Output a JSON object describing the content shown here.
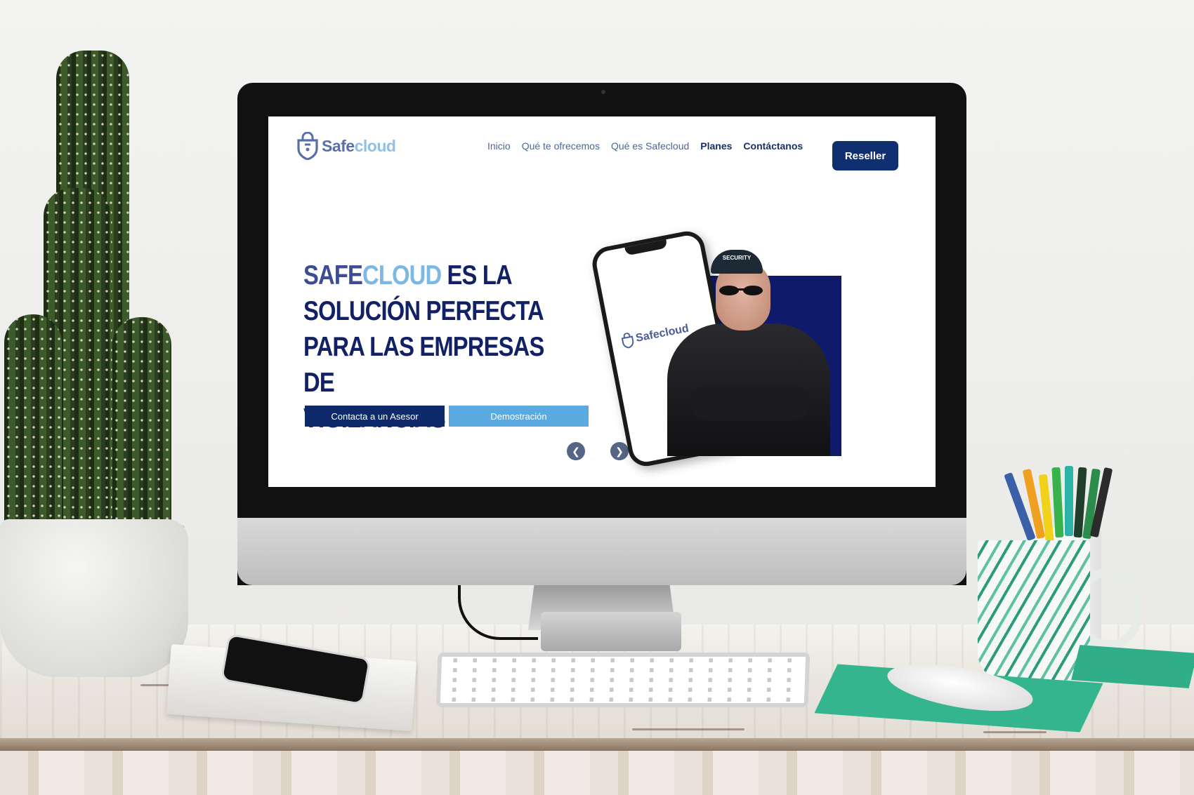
{
  "site": {
    "logo": {
      "part1": "Safe",
      "part2": "cloud"
    },
    "nav": {
      "items": [
        "Inicio",
        "Qué te ofrecemos",
        "Qué es Safecloud",
        "Planes",
        "Contáctanos"
      ],
      "cta": "Reseller"
    },
    "hero": {
      "headline_brand_a": "SAFE",
      "headline_brand_b": "CLOUD",
      "headline_rest_1": " ES LA",
      "headline_line2": "SOLUCIÓN PERFECTA",
      "headline_line3": "PARA LAS EMPRESAS DE",
      "headline_line4": "VIGILANCIAS",
      "button_primary": "Contacta a un Asesor",
      "button_secondary": "Demostración",
      "phone_logo": "Safecloud",
      "cap_text": "SECURITY"
    }
  },
  "colors": {
    "navy": "#0f2a6b",
    "light_blue": "#5aa9e0",
    "brand_text": "#4d6794",
    "hero_block": "#0f1a6a"
  }
}
